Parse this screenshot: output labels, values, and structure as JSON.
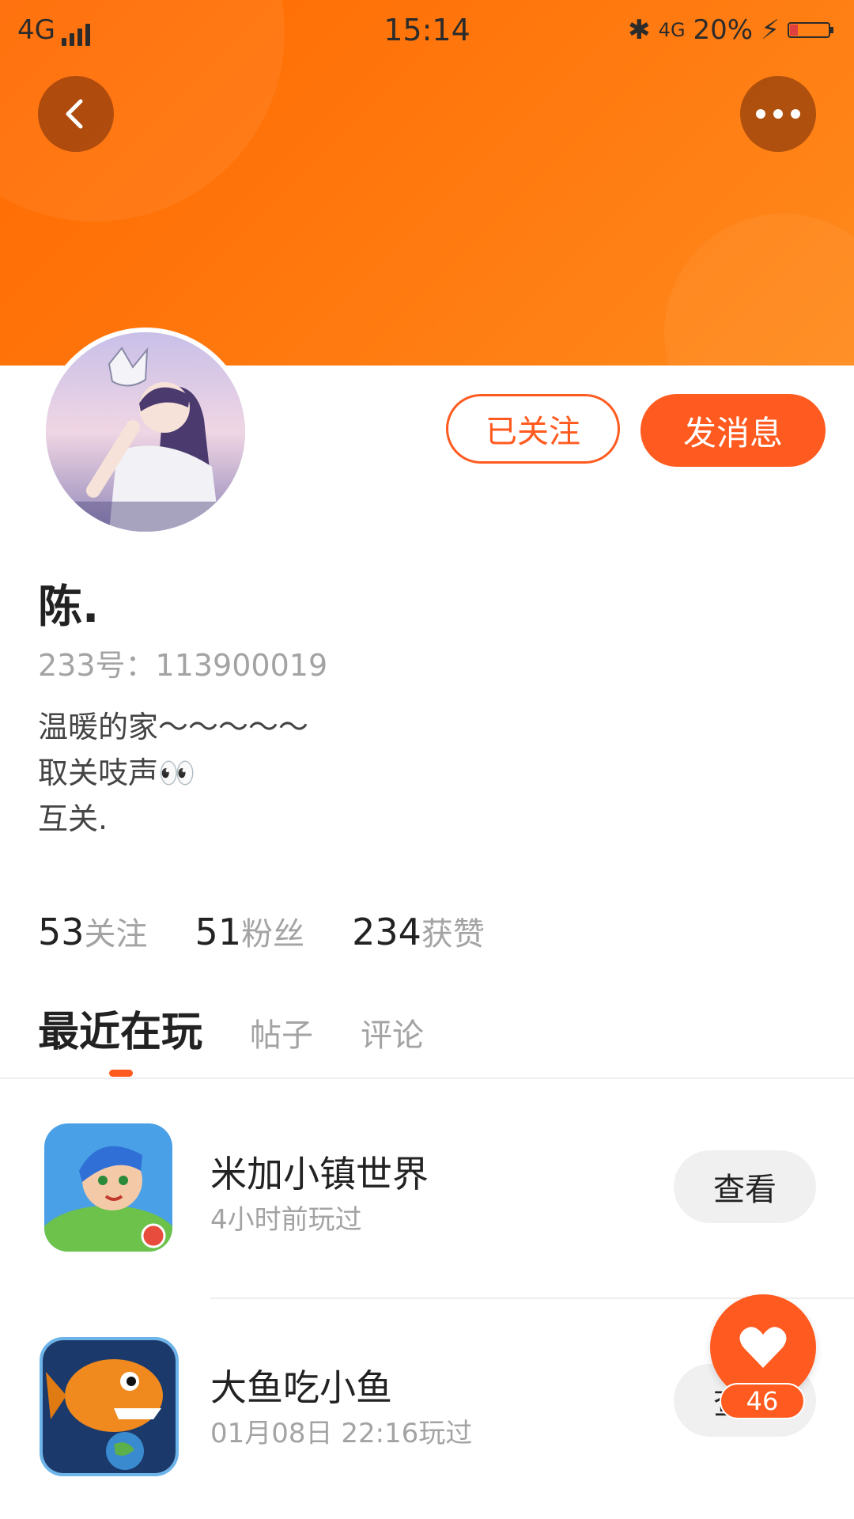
{
  "status_bar": {
    "network": "4G",
    "time": "15:14",
    "network2": "4G",
    "battery": "20%"
  },
  "profile": {
    "name": "陈.",
    "uid": "233号：113900019",
    "bio": [
      "温暖的家～～～～～",
      "取关吱声👀",
      "互关."
    ],
    "follow_button": "已关注",
    "message_button": "发消息"
  },
  "stats": [
    {
      "num": "53",
      "label": "关注"
    },
    {
      "num": "51",
      "label": "粉丝"
    },
    {
      "num": "234",
      "label": "获赞"
    }
  ],
  "tabs": [
    "最近在玩",
    "帖子",
    "评论"
  ],
  "games": [
    {
      "title": "米加小镇世界",
      "subtitle": "4小时前玩过",
      "button": "查看"
    },
    {
      "title": "大鱼吃小鱼",
      "subtitle": "01月08日 22:16玩过",
      "button": "查看"
    }
  ],
  "like_count": "46",
  "colors": {
    "accent": "#ff5a1f",
    "header": "#ff7a10"
  }
}
